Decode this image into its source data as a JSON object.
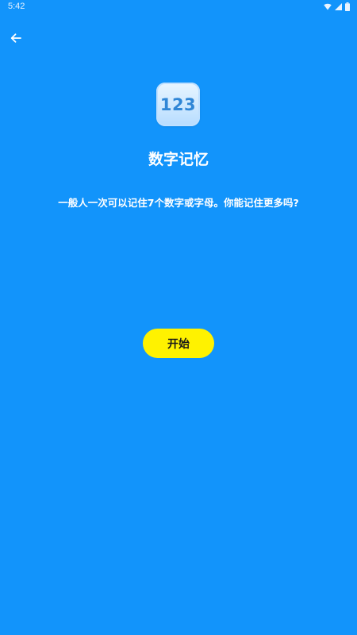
{
  "status_bar": {
    "time": "5:42",
    "icons": [
      "wifi-icon",
      "signal-icon",
      "battery-icon"
    ]
  },
  "header": {
    "back_icon": "arrow-left-icon"
  },
  "app": {
    "icon_label": "123",
    "title": "数字记忆",
    "description": "一般人一次可以记住7个数字或字母。你能记住更多吗?"
  },
  "actions": {
    "start_label": "开始"
  },
  "colors": {
    "background": "#1294fb",
    "button": "#fff200",
    "text": "#ffffff"
  }
}
